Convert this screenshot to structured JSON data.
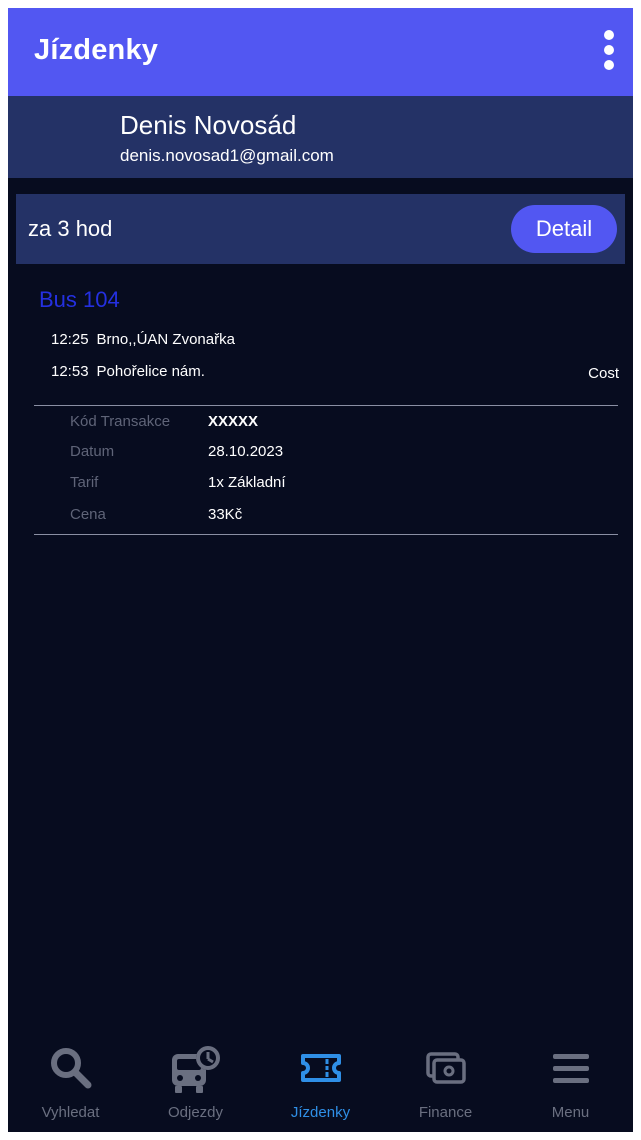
{
  "appbar": {
    "title": "Jízdenky",
    "menu_icon": "more-vert-icon"
  },
  "account": {
    "name": "Denis Novosád",
    "email": "denis.novosad1@gmail.com"
  },
  "ticket": {
    "when": "za 3 hod",
    "detail_label": "Detail",
    "line": "Bus 104",
    "stops": [
      {
        "time": "12:25",
        "name": "Brno,,ÚAN Zvonařka"
      },
      {
        "time": "12:53",
        "name": "Pohořelice nám."
      }
    ],
    "cost_label": "Cost",
    "details": [
      {
        "key": "Kód Transakce",
        "value": "XXXXX"
      },
      {
        "key": "Datum",
        "value": "28.10.2023"
      },
      {
        "key": "Tarif",
        "value": "1x Základní"
      },
      {
        "key": "Cena",
        "value": "33Kč"
      }
    ]
  },
  "nav": {
    "items": [
      {
        "label": "Vyhledat",
        "icon": "search-icon",
        "active": false
      },
      {
        "label": "Odjezdy",
        "icon": "bus-clock-icon",
        "active": false
      },
      {
        "label": "Jízdenky",
        "icon": "ticket-icon",
        "active": true
      },
      {
        "label": "Finance",
        "icon": "wallet-icon",
        "active": false
      },
      {
        "label": "Menu",
        "icon": "hamburger-menu-icon",
        "active": false
      }
    ]
  },
  "colors": {
    "background": "#070c1f",
    "appbar": "#5257f2",
    "panel": "#243266",
    "accent_line": "#2430e0",
    "nav_active": "#2f8fe6",
    "nav_inactive": "#6a6f80"
  }
}
